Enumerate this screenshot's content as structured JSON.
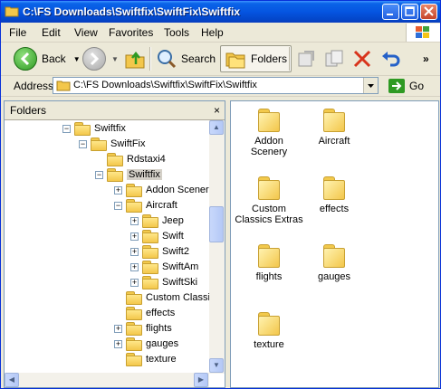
{
  "window": {
    "title": "C:\\FS Downloads\\Swiftfix\\SwiftFix\\Swiftfix"
  },
  "menu": [
    {
      "label": "File",
      "id": "file"
    },
    {
      "label": "Edit",
      "id": "edit"
    },
    {
      "label": "View",
      "id": "view"
    },
    {
      "label": "Favorites",
      "id": "favorites"
    },
    {
      "label": "Tools",
      "id": "tools"
    },
    {
      "label": "Help",
      "id": "help"
    }
  ],
  "toolbar": {
    "back_label": "Back",
    "search_label": "Search",
    "folders_label": "Folders"
  },
  "address": {
    "label": "Address",
    "path": "C:\\FS Downloads\\Swiftfix\\SwiftFix\\Swiftfix",
    "go_label": "Go"
  },
  "folders_pane": {
    "title": "Folders",
    "close_glyph": "×",
    "tree": [
      {
        "label": "Swiftfix",
        "expander": "−"
      },
      {
        "label": "SwiftFix",
        "expander": "−"
      },
      {
        "label": "Rdstaxi4",
        "expander": ""
      },
      {
        "label": "Swiftfix",
        "expander": "−"
      },
      {
        "label": "Addon Scener",
        "expander": "+"
      },
      {
        "label": "Aircraft",
        "expander": "−"
      },
      {
        "label": "Jeep",
        "expander": "+"
      },
      {
        "label": "Swift",
        "expander": "+"
      },
      {
        "label": "Swift2",
        "expander": "+"
      },
      {
        "label": "SwiftAm",
        "expander": "+"
      },
      {
        "label": "SwiftSki",
        "expander": "+"
      },
      {
        "label": "Custom Classi",
        "expander": ""
      },
      {
        "label": "effects",
        "expander": ""
      },
      {
        "label": "flights",
        "expander": "+"
      },
      {
        "label": "gauges",
        "expander": "+"
      },
      {
        "label": "texture",
        "expander": ""
      }
    ]
  },
  "content": {
    "items": [
      {
        "line1": "Addon",
        "line2": "Scenery"
      },
      {
        "line1": "Aircraft",
        "line2": ""
      },
      {
        "line1": "Custom",
        "line2": "Classics Extras"
      },
      {
        "line1": "effects",
        "line2": ""
      },
      {
        "line1": "flights",
        "line2": ""
      },
      {
        "line1": "gauges",
        "line2": ""
      },
      {
        "line1": "texture",
        "line2": ""
      }
    ]
  }
}
